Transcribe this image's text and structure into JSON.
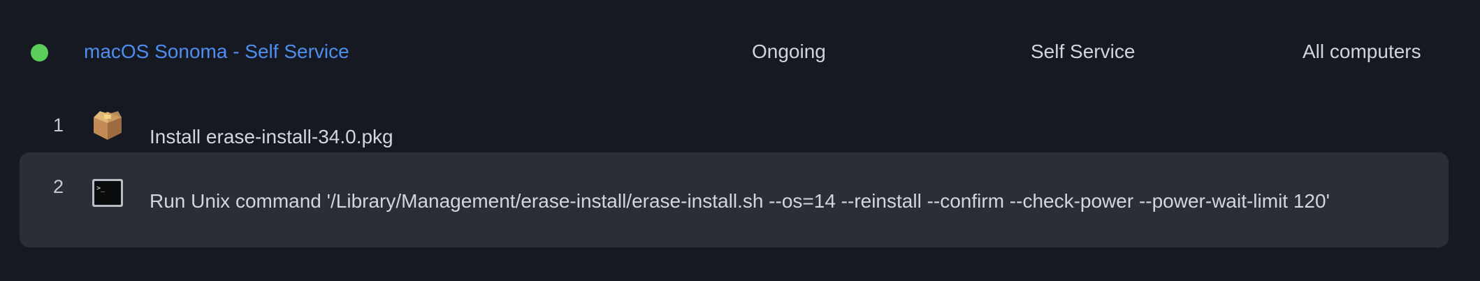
{
  "policy": {
    "name": "macOS Sonoma - Self Service",
    "status_color": "#5ccc5a",
    "frequency": "Ongoing",
    "trigger": "Self Service",
    "scope": "All computers"
  },
  "steps": [
    {
      "number": "1",
      "icon": "package-icon",
      "text": "Install erase-install-34.0.pkg"
    },
    {
      "number": "2",
      "icon": "terminal-icon",
      "text": "Run Unix command '/Library/Management/erase-install/erase-install.sh --os=14 --reinstall --confirm --check-power --power-wait-limit 120'"
    }
  ]
}
